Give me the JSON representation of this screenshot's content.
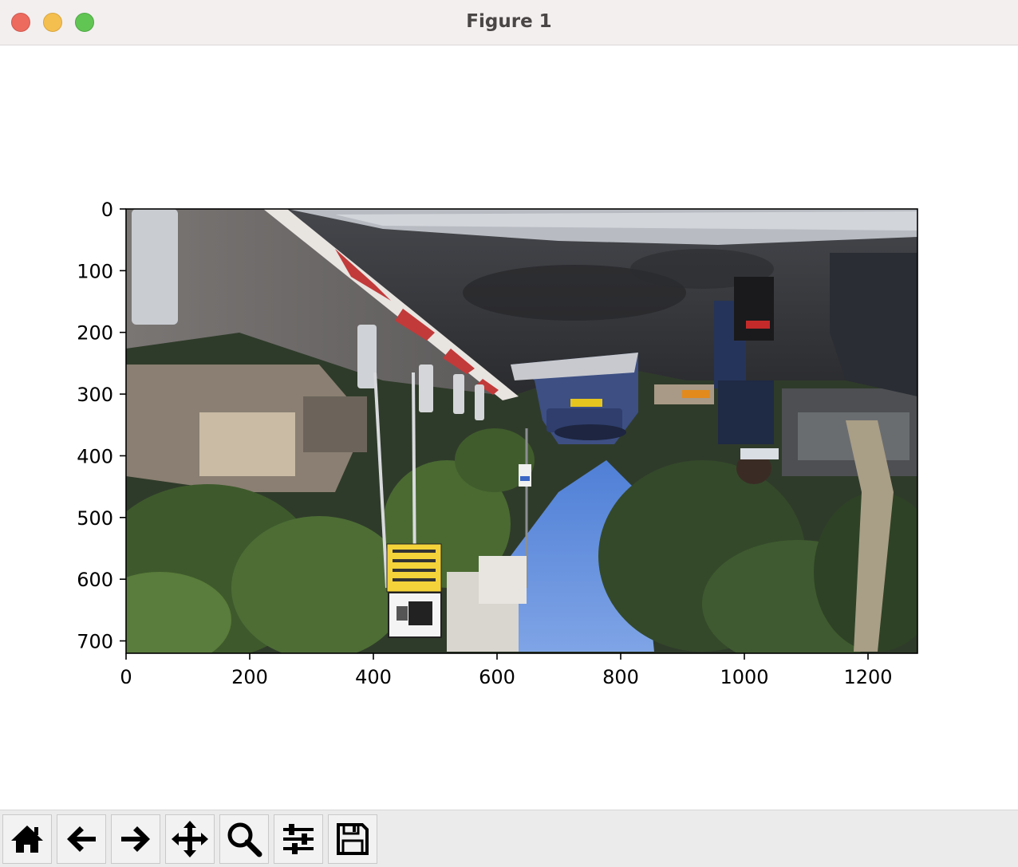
{
  "window": {
    "title": "Figure 1",
    "buttons": [
      "close-button",
      "minimize-button",
      "zoom-button"
    ]
  },
  "plot": {
    "image": "upside-down street scene photo",
    "x_ticks": [
      0,
      200,
      400,
      600,
      800,
      1000,
      1200
    ],
    "y_ticks": [
      0,
      100,
      200,
      300,
      400,
      500,
      600,
      700
    ],
    "x_lim": [
      0,
      1280
    ],
    "y_lim": [
      720,
      0
    ]
  },
  "toolbar": {
    "items": [
      {
        "name": "home-icon"
      },
      {
        "name": "back-arrow-icon"
      },
      {
        "name": "forward-arrow-icon"
      },
      {
        "name": "pan-move-icon"
      },
      {
        "name": "zoom-magnifier-icon"
      },
      {
        "name": "configure-subplots-icon"
      },
      {
        "name": "save-floppy-icon"
      }
    ]
  },
  "colors": {
    "titlebar_bg": "#f3efef",
    "toolbar_bg": "#ebebeb",
    "close": "#ed6a5e",
    "minimize": "#f5bf4f",
    "zoom": "#61c554"
  }
}
